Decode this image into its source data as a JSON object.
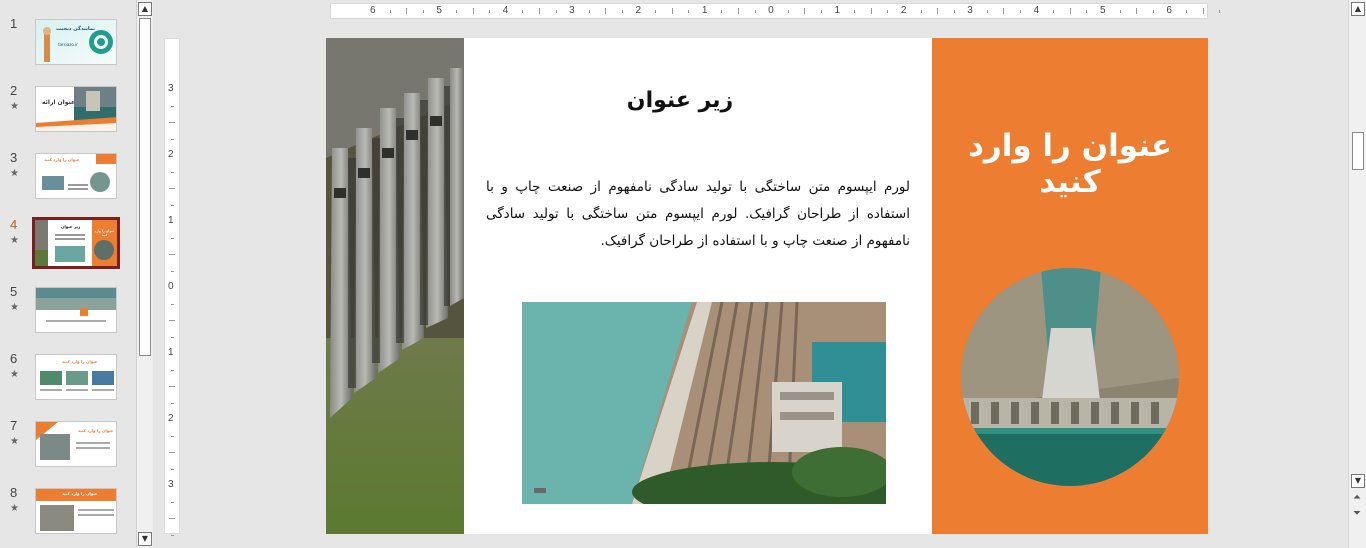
{
  "thumbnails": [
    {
      "num": "1",
      "star": false,
      "selected": false
    },
    {
      "num": "2",
      "star": true,
      "selected": false
    },
    {
      "num": "3",
      "star": true,
      "selected": false
    },
    {
      "num": "4",
      "star": true,
      "selected": true
    },
    {
      "num": "5",
      "star": true,
      "selected": false
    },
    {
      "num": "6",
      "star": true,
      "selected": false
    },
    {
      "num": "7",
      "star": true,
      "selected": false
    },
    {
      "num": "8",
      "star": true,
      "selected": false
    }
  ],
  "star_glyph": "★",
  "ruler": {
    "horizontal_labels": [
      "6",
      "5",
      "4",
      "3",
      "2",
      "1",
      "0",
      "1",
      "2",
      "3",
      "4",
      "5",
      "6"
    ],
    "vertical_labels": [
      "3",
      "2",
      "1",
      "0",
      "1",
      "2",
      "3"
    ]
  },
  "slide": {
    "title": "عنوان را وارد کنید",
    "subtitle": "زیر عنوان",
    "body": "لورم ایپسوم متن ساختگی با تولید سادگی نامفهوم از صنعت چاپ و با استفاده از طراحان گرافیک. لورم ایپسوم متن ساختگی با تولید سادگی نامفهوم از صنعت چاپ و با استفاده از طراحان گرافیک.",
    "colors": {
      "accent": "#ed7d31",
      "selected_border": "#7b1e1e",
      "active_number": "#c55a11"
    }
  },
  "thumb_texts": {
    "t1_title": "نمایندگی دیجیت",
    "t1_url": "tarsiazo.ir",
    "t2_title": "عنوان ارائه",
    "t3_title": "عنوان را وارد کنید",
    "t4_title": "عنوان را وارد کنید",
    "t4_sub": "زیر عنوان",
    "t6_title": "عنوان را وارد کنید",
    "t7_title": "عنوان را وارد کنید",
    "t8_title": "عنوان را وارد کنید"
  }
}
